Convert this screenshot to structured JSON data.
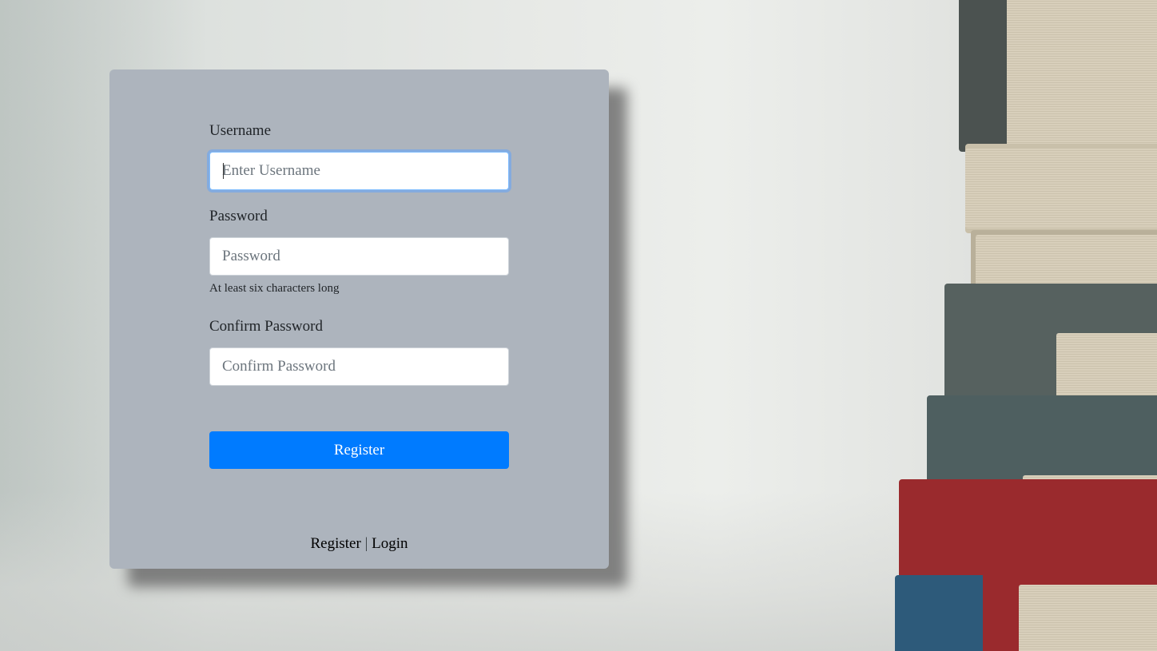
{
  "form": {
    "username_label": "Username",
    "username_placeholder": "Enter Username",
    "username_value": "",
    "password_label": "Password",
    "password_placeholder": "Password",
    "password_value": "",
    "password_hint": "At least six characters long",
    "confirm_label": "Confirm Password",
    "confirm_placeholder": "Confirm Password",
    "confirm_value": "",
    "submit_label": "Register"
  },
  "footer": {
    "register_link": "Register",
    "separator": "|",
    "login_link": "Login"
  },
  "colors": {
    "accent": "#007bff",
    "card_background": "#adb4bd",
    "focus_ring": "#80bdff"
  }
}
